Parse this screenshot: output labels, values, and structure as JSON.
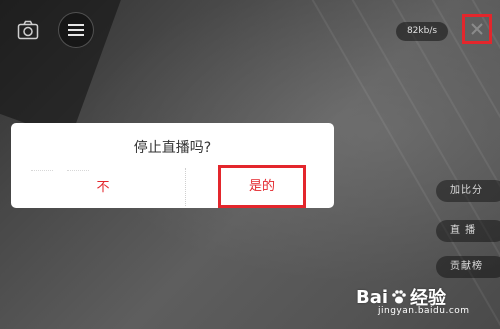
{
  "top_bar": {
    "speed": "82kb/s"
  },
  "side_buttons": [
    {
      "label": "加比分"
    },
    {
      "label": "直 播"
    },
    {
      "label": "贡献榜"
    }
  ],
  "dialog": {
    "title": "停止直播吗?",
    "cancel_label": "不",
    "confirm_label": "是的"
  },
  "watermark": {
    "logo": "Bai",
    "logo_suffix": "经验",
    "url": "jingyan.baidu.com"
  },
  "colors": {
    "accent_red": "#e3262c"
  },
  "icons": {
    "camera": "camera-icon",
    "menu": "menu-icon",
    "close": "close-icon"
  }
}
